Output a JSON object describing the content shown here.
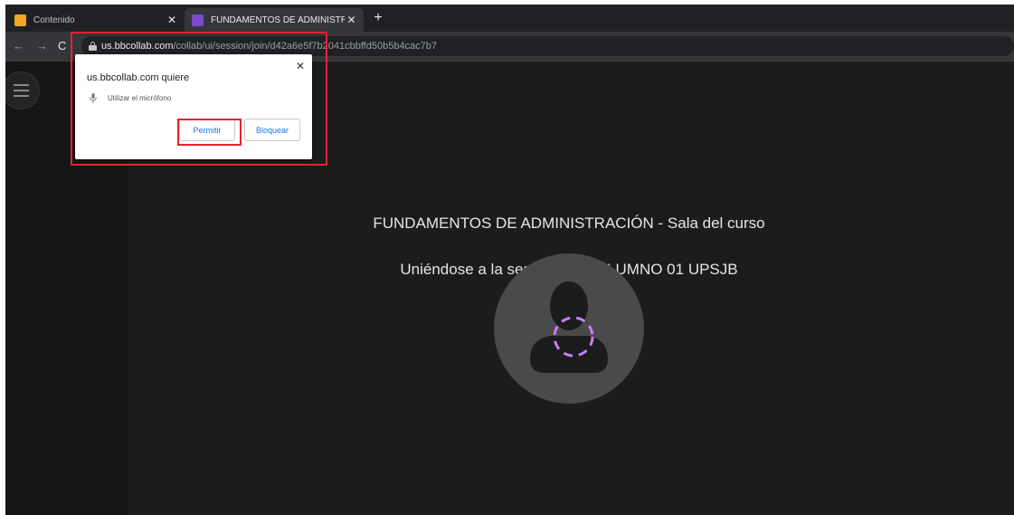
{
  "browser": {
    "tabs": [
      {
        "title": "Contenido",
        "icon": "blackboard-content-icon",
        "icon_color": "#f5a623"
      },
      {
        "title": "FUNDAMENTOS DE ADMINISTRA",
        "icon": "collaborate-icon",
        "icon_color": "#7b4bc9"
      }
    ],
    "url_host": "us.bbcollab.com",
    "url_path": "/collab/ui/session/join/d42a6e5f7b2041cbbffd50b5b4cac7b7"
  },
  "permission_popup": {
    "host_text": "us.bbcollab.com quiere",
    "permission_text": "Utilizar el micrófono",
    "allow_label": "Permitir",
    "block_label": "Bloquear"
  },
  "session": {
    "title": "FUNDAMENTOS DE ADMINISTRACIÓN - Sala del curso",
    "joining_text": "Uniéndose a la sesión como ALUMNO 01 UPSJB"
  },
  "colors": {
    "highlight": "#e2242f",
    "accent": "#c77dff",
    "background": "#1c1c1c"
  }
}
